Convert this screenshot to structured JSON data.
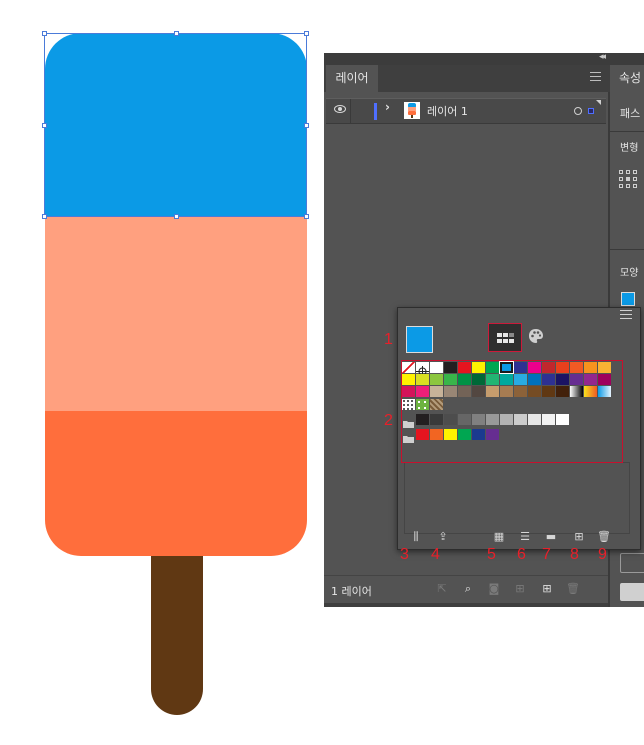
{
  "colors": {
    "popsicle_blue": "#0b9ae6",
    "popsicle_peach": "#ffa07f",
    "popsicle_orange": "#ff6e3c",
    "stick_brown": "#603813",
    "panel_bg": "#535353",
    "annotation_red": "#e8202a"
  },
  "layers_panel": {
    "tab_label": "레이어",
    "menu_icon": "hamburger-icon",
    "layer": {
      "name": "레이어 1",
      "visible": true,
      "expanded": false
    },
    "footer_count": "1 레이어",
    "footer_icons": [
      "export-icon",
      "search-icon",
      "clip-mask-icon",
      "new-sublayer-icon",
      "new-layer-icon",
      "trash-icon"
    ]
  },
  "properties_panel": {
    "tab_label": "속성",
    "path_label": "패스",
    "transform_label": "변형",
    "appearance_label": "모양",
    "fill_color": "#0b9ae6"
  },
  "swatch_popup": {
    "fill_color": "#0b9ae6",
    "tabs": [
      "swatches-icon",
      "color-palette-icon"
    ],
    "footer_icons": [
      "swatch-library-icon",
      "add-to-library-icon",
      "show-swatch-kinds-icon",
      "swatch-options-icon",
      "new-color-group-icon",
      "new-swatch-icon",
      "trash-icon"
    ],
    "rows": [
      [
        "#ffffff:none",
        "#ffffff:reg",
        "#ffffff",
        "#231f20",
        "#e5141f",
        "#fff200",
        "#00a651",
        "#0b9ae6:sel",
        "#2e3192",
        "#ec008c",
        "#c1272d",
        "#e8401c",
        "#f15a24",
        "#f7931e",
        "#f9b233"
      ],
      [
        "#fff200",
        "#d9e021",
        "#8cc63f",
        "#39b54a",
        "#009245",
        "#006837",
        "#22b573",
        "#00a99d",
        "#29abe2",
        "#0071bc",
        "#2e3192",
        "#1b1464",
        "#662d91",
        "#93278f",
        "#9e005d"
      ],
      [
        "#d4145a",
        "#ed1e79",
        "#c7b299",
        "#998675",
        "#736357",
        "#534741",
        "#c69c6d",
        "#a67c52",
        "#8c6239",
        "#754c24",
        "#603813",
        "#42210b",
        "#gradient-bw",
        "#gradient-orange",
        "#gradient-blue"
      ],
      [
        "#pattern-dots",
        "#pattern-green",
        "#pattern-brown"
      ],
      [
        "#folder",
        "#231f20",
        "#3a3a3a",
        "#4d4d4d",
        "#666666",
        "#808080",
        "#999999",
        "#b3b3b3",
        "#cccccc",
        "#e6e6e6",
        "#f2f2f2",
        "#ffffff"
      ],
      [
        "#folder",
        "#e5141f",
        "#f26522",
        "#fff200",
        "#00a651",
        "#1b3a8f",
        "#662d91"
      ]
    ]
  },
  "annotations": [
    "1",
    "2",
    "3",
    "4",
    "5",
    "6",
    "7",
    "8",
    "9"
  ]
}
